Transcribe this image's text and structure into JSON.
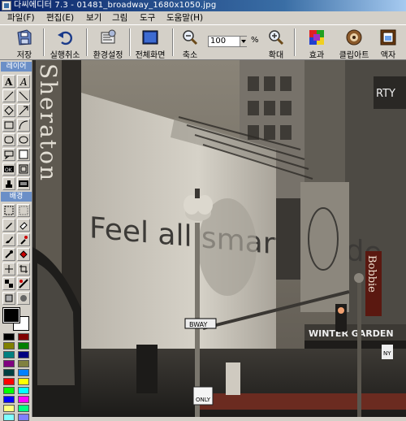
{
  "window": {
    "title": "다씨에디터 7.3 - 01481_broadway_1680x1050.jpg"
  },
  "menu": [
    "파일(F)",
    "편집(E)",
    "보기",
    "그림",
    "도구",
    "도움말(H)"
  ],
  "toolbar": {
    "save": "저장",
    "undo": "실행취소",
    "settings": "환경설정",
    "fullscreen": "전체화면",
    "zoom_out": "축소",
    "zoom_value": "100",
    "zoom_unit": "%",
    "zoom_in": "확대",
    "effects": "효과",
    "clipart": "클립아트",
    "frame": "액자"
  },
  "palette": {
    "layer_label": "레이어",
    "background_label": "배경",
    "colors": [
      "#000000",
      "#800000",
      "#808000",
      "#008000",
      "#008080",
      "#000080",
      "#800080",
      "#808040",
      "#004040",
      "#0080ff",
      "#ff0000",
      "#ffff00",
      "#00ff00",
      "#00ffff",
      "#0000ff",
      "#ff00ff",
      "#ffff80",
      "#00ff80",
      "#80ffff",
      "#8080ff"
    ]
  },
  "canvas": {
    "billboard_text": "Feel all smart inside",
    "hotel_sign": "Sheraton",
    "street_sign": "BWAY",
    "marquee_text": "WINTER GARDEN",
    "side_sign": "Bobbie",
    "one_way": "ONLY",
    "parking_sign": "NY"
  }
}
